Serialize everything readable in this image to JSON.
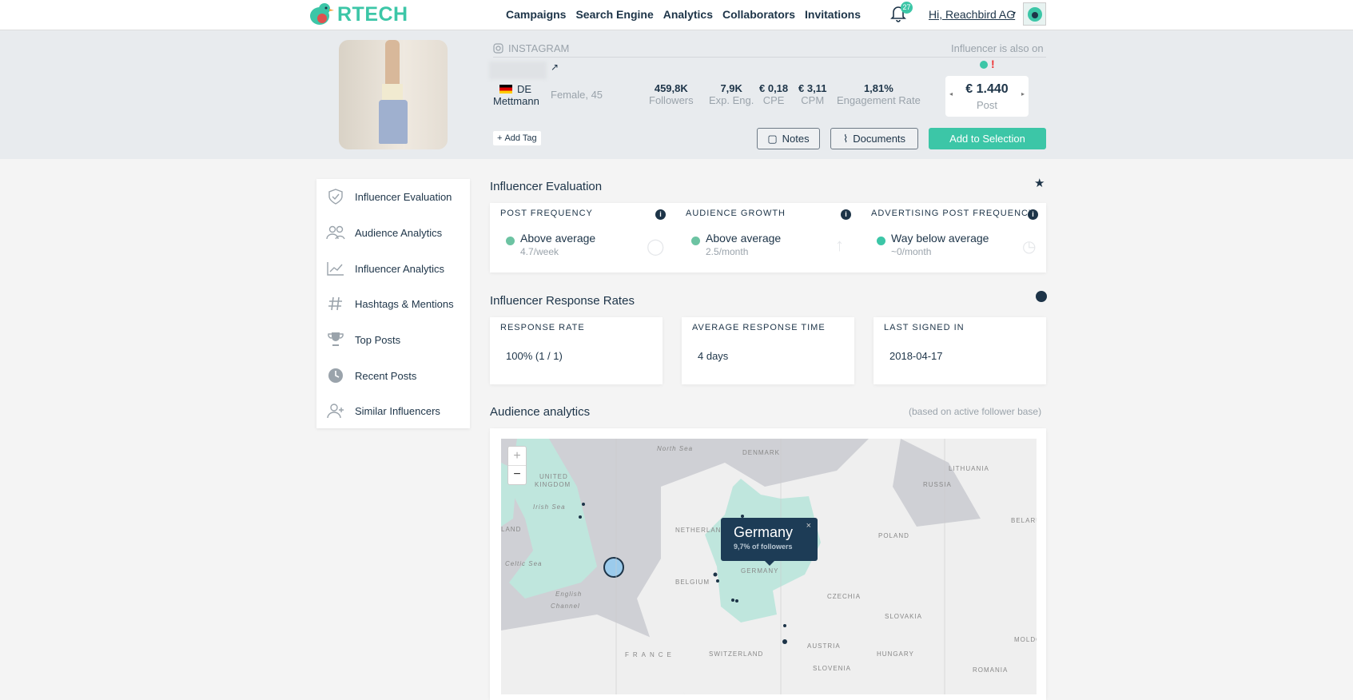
{
  "nav": {
    "brand": "RTECH",
    "links": [
      "Campaigns",
      "Search Engine",
      "Analytics",
      "Collaborators",
      "Invitations"
    ],
    "notifications": "27",
    "user": "Hi, Reachbird AG"
  },
  "profile": {
    "platform": "INSTAGRAM",
    "also_on": "Influencer is also on",
    "country": "DE",
    "city": "Mettmann",
    "demographic": "Female, 45",
    "stats": [
      {
        "value": "459,8K",
        "label": "Followers"
      },
      {
        "value": "7,9K",
        "label": "Exp. Eng."
      },
      {
        "value": "€ 0,18",
        "label": "CPE"
      },
      {
        "value": "€ 3,11",
        "label": "CPM"
      },
      {
        "value": "1,81%",
        "label": "Engagement Rate"
      }
    ],
    "price": "€ 1.440",
    "price_label": "Post",
    "add_tag": "Add Tag",
    "notes": "Notes",
    "documents": "Documents",
    "add_selection": "Add to Selection"
  },
  "sidebar": {
    "items": [
      "Influencer Evaluation",
      "Audience Analytics",
      "Influencer Analytics",
      "Hashtags & Mentions",
      "Top Posts",
      "Recent Posts",
      "Similar Influencers"
    ]
  },
  "evaluation": {
    "title": "Influencer Evaluation",
    "cards": [
      {
        "caption": "POST FREQUENCY",
        "status": "Above average",
        "detail": "4.7/week"
      },
      {
        "caption": "AUDIENCE GROWTH",
        "status": "Above average",
        "detail": "2.5/month"
      },
      {
        "caption": "ADVERTISING POST FREQUENCY",
        "status": "Way below average",
        "detail": "~0/month"
      }
    ]
  },
  "response": {
    "title": "Influencer Response Rates",
    "cards": [
      {
        "caption": "RESPONSE RATE",
        "value": "100% (1 / 1)"
      },
      {
        "caption": "AVERAGE RESPONSE TIME",
        "value": "4 days"
      },
      {
        "caption": "LAST SIGNED IN",
        "value": "2018-04-17"
      }
    ]
  },
  "audience": {
    "title": "Audience analytics",
    "note": "(based on active follower base)",
    "tooltip": {
      "country": "Germany",
      "share": "9,7% of followers"
    },
    "map_labels": [
      "North Sea",
      "DENMARK",
      "UNITED",
      "KINGDOM",
      "Irish Sea",
      "LAND",
      "NETHERLANDS",
      "GERMANY",
      "POLAND",
      "LITHUANIA",
      "RUSSIA",
      "BELARUS",
      "Celtic Sea",
      "BELGIUM",
      "English",
      "Channel",
      "CZECHIA",
      "SLOVAKIA",
      "FRANCE",
      "SWITZERLAND",
      "AUSTRIA",
      "HUNGARY",
      "MOLDOVA",
      "SLOVENIA",
      "ROMANIA"
    ]
  },
  "colors": {
    "accent": "#3cc6a7",
    "navy": "#1d3448",
    "status_green": "#6cc3a2",
    "highlight_land": "#bfe6dd"
  }
}
